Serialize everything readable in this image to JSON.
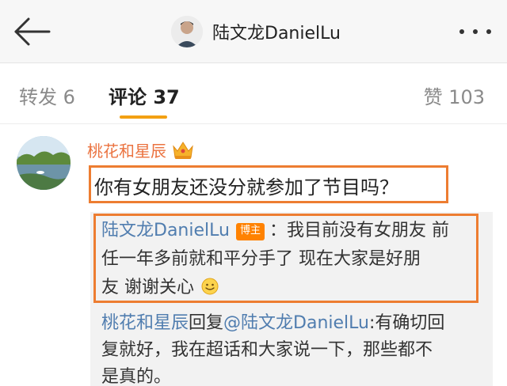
{
  "header": {
    "title": "陆文龙DanielLu"
  },
  "tabs": {
    "repost": "转发 6",
    "comments": "评论 37",
    "likes": "赞 103"
  },
  "comment": {
    "username": "桃花和星辰",
    "text": "你有女朋友还没分就参加了节目吗？",
    "replies": {
      "author_reply": {
        "author": "陆文龙DanielLu",
        "badge": "博主",
        "line1": "：我目前没有女朋友 前",
        "line2": "任一年多前就和平分手了 现在大家是好朋",
        "line3": "友 谢谢关心"
      },
      "user_reply": {
        "author": "桃花和星辰",
        "verb": "回复",
        "mention": "@陆文龙DanielLu",
        "line1_rest": ":有确切回",
        "line2": "复就好，我在超话和大家说一下，那些都不",
        "line3": "是真的。"
      }
    }
  },
  "colors": {
    "username": "#eb7340",
    "link": "#507daf",
    "highlight": "#ed7d31",
    "tab_underline": "#f3a012",
    "badge": "#ff8200"
  },
  "icons": [
    "back-arrow-icon",
    "more-icon",
    "crown-icon",
    "smile-emoji-icon"
  ]
}
